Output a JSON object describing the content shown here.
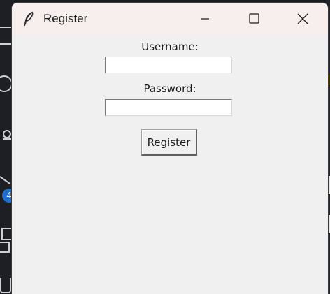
{
  "background": {
    "notification_badge": "4"
  },
  "window": {
    "title": "Register",
    "app_icon": "feather-icon",
    "controls": {
      "minimize_icon": "minimize-icon",
      "maximize_icon": "maximize-icon",
      "close_icon": "close-icon"
    }
  },
  "form": {
    "username_label": "Username:",
    "username_value": "",
    "password_label": "Password:",
    "password_value": "",
    "register_button_label": "Register"
  },
  "colors": {
    "titlebar_bg": "#f7eeee",
    "window_bg": "#f0f0f0",
    "badge": "#1f6fd1"
  }
}
